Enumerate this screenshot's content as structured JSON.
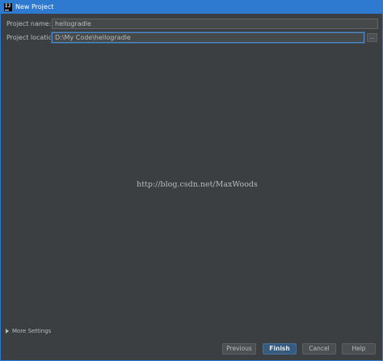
{
  "window": {
    "title": "New Project",
    "app_icon_text": "IJ"
  },
  "form": {
    "project_name_label": "Project name:",
    "project_name_value": "hellogradle",
    "project_location_label": "Project location:",
    "project_location_value": "D:\\My Code\\hellogradle",
    "browse_label": "..."
  },
  "watermark": "http://blog.csdn.net/MaxWoods",
  "more_settings_label": "More Settings",
  "buttons": {
    "previous": "Previous",
    "finish": "Finish",
    "cancel": "Cancel",
    "help": "Help"
  },
  "colors": {
    "titlebar": "#2e7ad1",
    "background": "#3c3f41",
    "default_button": "#375a7f"
  }
}
